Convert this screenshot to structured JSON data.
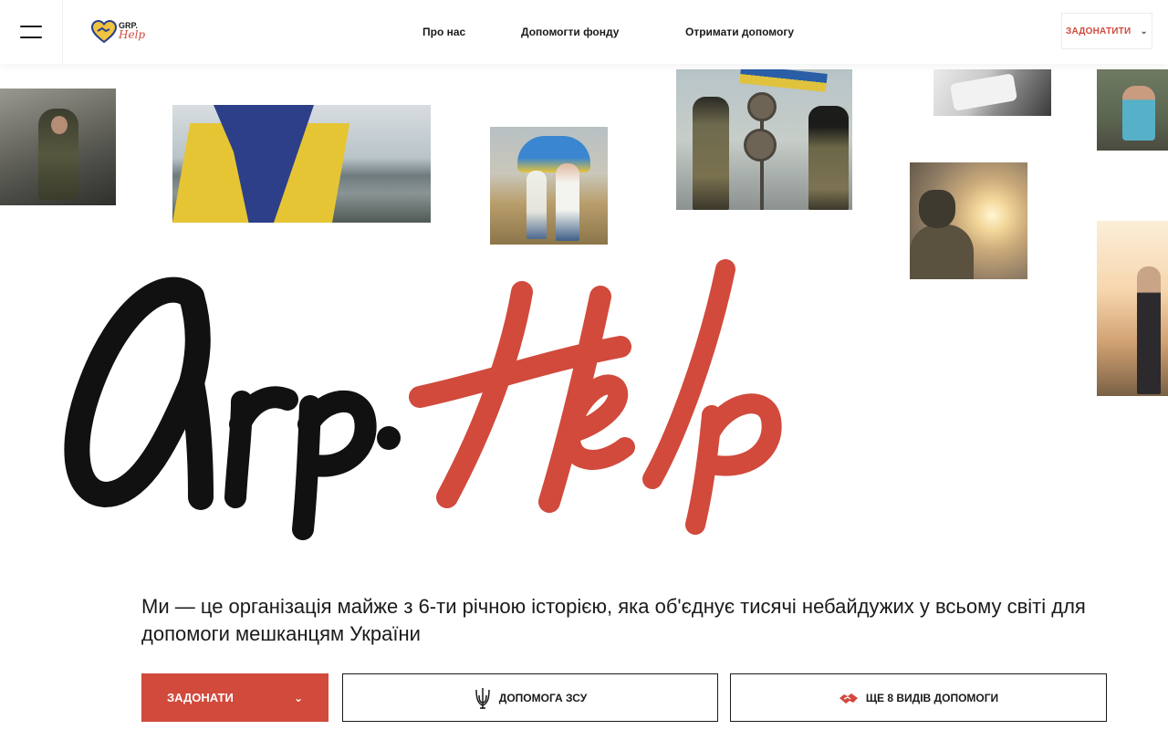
{
  "header": {
    "logo_line1": "GRP.",
    "logo_line2": "Help",
    "nav": [
      {
        "label": "Про нас"
      },
      {
        "label": "Допомогти фонду"
      },
      {
        "label": "Отримати допомогу"
      }
    ],
    "donate_label": "ЗАДОНАТИТИ",
    "chevron": "⌄"
  },
  "hero": {
    "logo_part1": "Grp",
    "logo_part2": "Help",
    "colors": {
      "dark": "#111111",
      "accent": "#d14a3c"
    }
  },
  "main": {
    "description": "Ми — це організація майже з 6-ти річною історією, яка об'єднує тисячі небайдужих у всьому світі для допомоги мешканцям України"
  },
  "actions": {
    "donate_label": "ЗАДОНАТИ",
    "donate_chevron": "⌄",
    "zsu_label": "ДОПОМОГА ЗСУ",
    "more_label": "ЩЕ 8 ВИДІВ ДОПОМОГИ"
  },
  "icons": {
    "menu": "hamburger-icon",
    "logo": "heart-handshake-icon",
    "zsu": "trident-icon",
    "more": "handshake-icon"
  }
}
